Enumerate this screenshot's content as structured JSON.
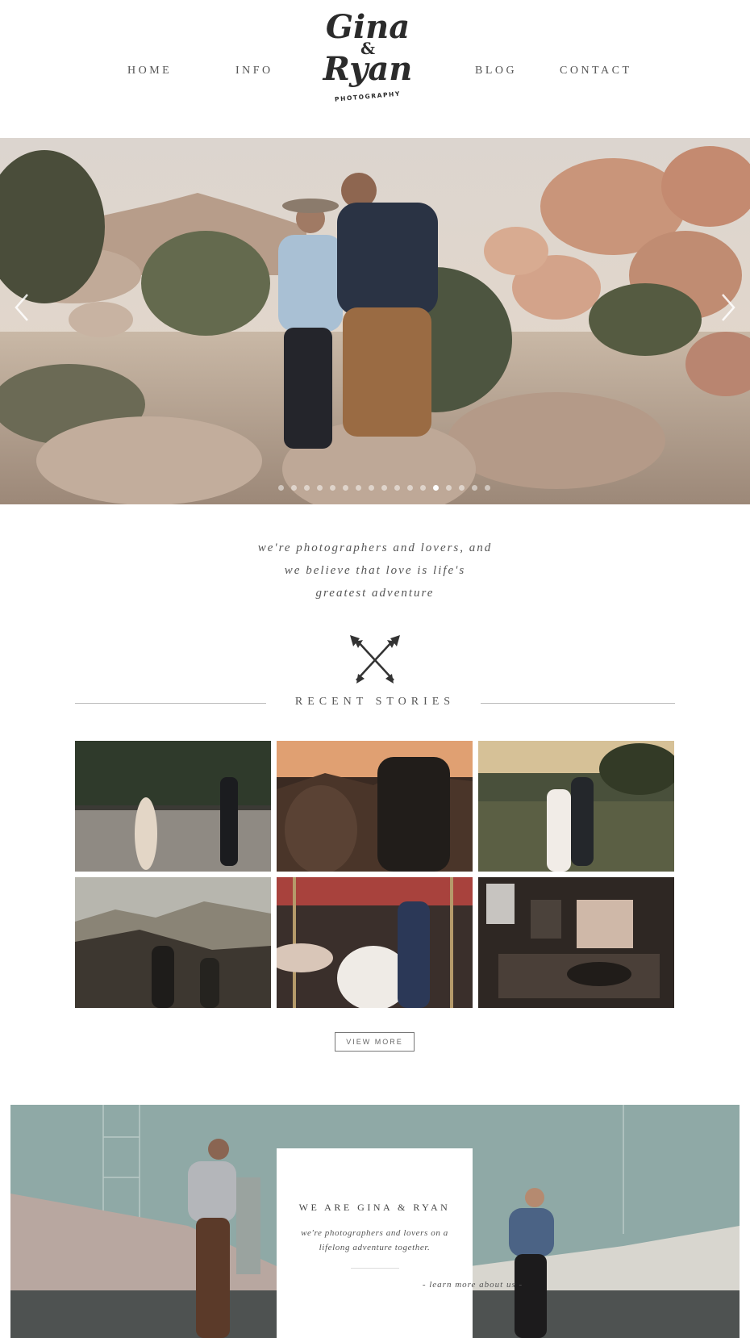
{
  "nav": {
    "home": "HOME",
    "info": "INFO",
    "blog": "BLOG",
    "contact": "CONTACT"
  },
  "logo": {
    "line1": "Gina",
    "amp": "&",
    "line2": "Ryan",
    "sub": "PHOTOGRAPHY"
  },
  "hero": {
    "slide_count": 17,
    "active_slide": 13
  },
  "tagline": {
    "lines": [
      "we're photographers and lovers, and",
      "we believe that love is life's",
      "greatest adventure"
    ]
  },
  "recent": {
    "title": "RECENT STORIES",
    "view_more": "VIEW MORE"
  },
  "about": {
    "title": "WE ARE GINA & RYAN",
    "desc": "we're photographers and lovers on a lifelong adventure together.",
    "link": "- learn more about us -"
  },
  "colors": {
    "text": "#444444",
    "rule": "#bbbbbb",
    "about_sky": "#8fa9a6"
  }
}
